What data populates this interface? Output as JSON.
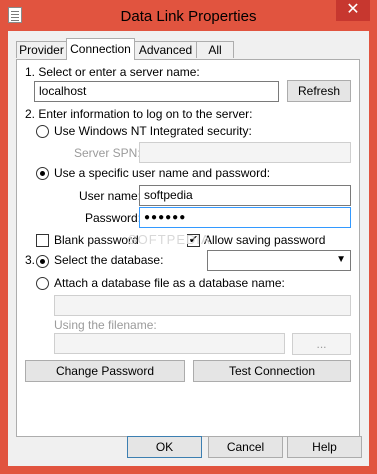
{
  "window": {
    "title": "Data Link Properties",
    "close_glyph": "✕"
  },
  "tabs": [
    {
      "label": "Provider",
      "active": false
    },
    {
      "label": "Connection",
      "active": true
    },
    {
      "label": "Advanced",
      "active": false
    },
    {
      "label": "All",
      "active": false
    }
  ],
  "connection": {
    "step1_label": "1. Select or enter a server name:",
    "server_name": "localhost",
    "refresh_label": "Refresh",
    "step2_label": "2. Enter information to log on to the server:",
    "nt_security_label": "Use Windows NT Integrated security:",
    "server_spn_label": "Server SPN:",
    "server_spn_value": "",
    "specific_user_label": "Use a specific user name and password:",
    "user_name_label": "User name:",
    "user_name_value": "softpedia",
    "password_label": "Password:",
    "password_value": "●●●●●●",
    "blank_password_label": "Blank password",
    "blank_password_checked": false,
    "allow_saving_label": "Allow saving password",
    "allow_saving_checked": true,
    "step3_prefix": "3.",
    "select_db_label": "Select the database:",
    "database_value": "",
    "attach_db_label": "Attach a database file as a database name:",
    "attach_db_value": "",
    "using_filename_label": "Using the filename:",
    "filename_value": "",
    "browse_label": "...",
    "change_password_label": "Change Password",
    "test_connection_label": "Test Connection",
    "watermark": "SOFTPEDIA"
  },
  "footer": {
    "ok_label": "OK",
    "cancel_label": "Cancel",
    "help_label": "Help"
  },
  "colors": {
    "frame": "#e1543f",
    "close": "#c7372f",
    "focus_border": "#3399ff"
  }
}
